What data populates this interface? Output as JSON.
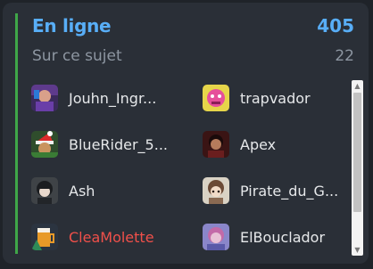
{
  "header": {
    "title": "En ligne",
    "count": "405",
    "subtitle": "Sur ce sujet",
    "subcount": "22"
  },
  "users": [
    {
      "name": "Jouhn_Ingr...",
      "avatar": "avatar-portrait-icon"
    },
    {
      "name": "trapvador",
      "avatar": "avatar-pink-character-icon"
    },
    {
      "name": "BlueRider_5...",
      "avatar": "avatar-christmas-icon"
    },
    {
      "name": "Apex",
      "avatar": "avatar-dark-portrait-icon"
    },
    {
      "name": "Ash",
      "avatar": "avatar-dark-hair-anime-icon"
    },
    {
      "name": "Pirate_du_G...",
      "avatar": "avatar-anime-character-icon"
    },
    {
      "name": "CleaMolette",
      "avatar": "avatar-beer-icon",
      "highlight": "#f0504a"
    },
    {
      "name": "ElBouclador",
      "avatar": "avatar-purple-portrait-icon"
    }
  ],
  "colors": {
    "accent": "#58aef7",
    "online_bar": "#3fa648",
    "panel": "#2a2f37",
    "muted": "#8d96a1",
    "highlight": "#f0504a"
  }
}
